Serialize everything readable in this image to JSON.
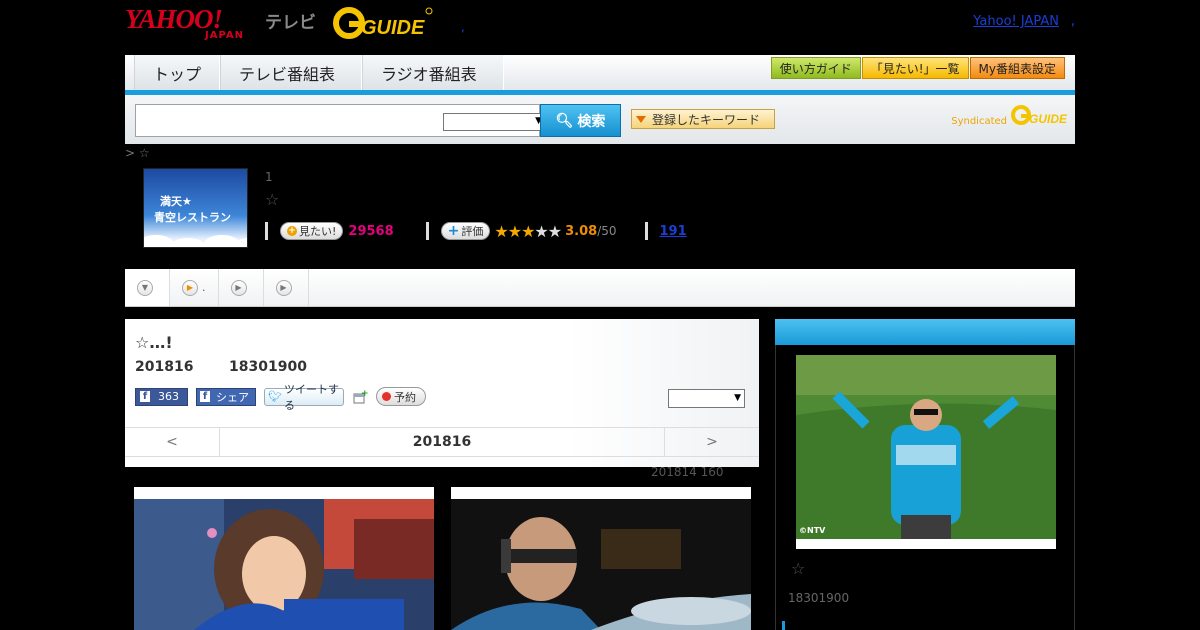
{
  "header": {
    "logo_yahoo": "YAHOO!",
    "logo_japan": "JAPAN",
    "tv_label": "テレビ",
    "gguide_label": "GUIDE",
    "dot": ",",
    "yj_link": "Yahoo! JAPAN",
    "yj_dot": ","
  },
  "nav": {
    "tabs": [
      "トップ",
      "テレビ番組表",
      "ラジオ番組表"
    ],
    "buttons": [
      "使い方ガイド",
      "「見たい!」一覧",
      "My番組表設定"
    ]
  },
  "search": {
    "input_value": "",
    "select_value": "",
    "search_label": "検索",
    "keyword_label": "登録したキーワード",
    "syndicated_label": "Syndicated"
  },
  "breadcrumb": "> ☆",
  "program": {
    "thumb_line1": "満天★",
    "thumb_line2": "青空レストラン",
    "number": "1",
    "star": "☆",
    "mitai_label": "見たい!",
    "mitai_count": "29568",
    "hyouka_label": "評価",
    "rating": 3.08,
    "rating_text": "3.08",
    "rating_max": "/50",
    "review_count": "191"
  },
  "subtabs": [
    {
      "label": ""
    },
    {
      "label": "."
    },
    {
      "label": ""
    },
    {
      "label": ""
    }
  ],
  "episode": {
    "title": "☆…!",
    "date": "201816",
    "time": "18301900",
    "fb_like_count": "363",
    "fb_share_label": "シェア",
    "tweet_label": "ツイートする",
    "yoyaku_label": "予約",
    "select_value": "",
    "pager_prev": "<",
    "pager_center": "201816",
    "pager_next": ">"
  },
  "meta_line": "201814  160",
  "side": {
    "photo_credit": "©NTV",
    "star": "☆",
    "time": "18301900"
  },
  "colors": {
    "accent_blue": "#1a9ddc",
    "yahoo_red": "#d6001c",
    "mitai_pink": "#e4007f",
    "score_orange": "#f08c00"
  }
}
